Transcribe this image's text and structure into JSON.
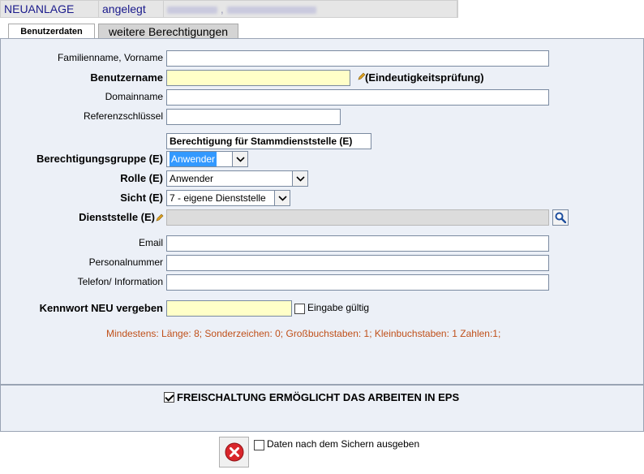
{
  "header": {
    "status": "NEUANLAGE",
    "state": "angelegt",
    "user_info": ""
  },
  "tabs": {
    "user_data": "Benutzerdaten",
    "more_permissions": "weitere Berechtigungen"
  },
  "form": {
    "name_label": "Familienname, Vorname",
    "name_value": "",
    "username_label": "Benutzername",
    "username_value": "",
    "uniqueness_check": "(Eindeutigkeitsprüfung)",
    "domain_label": "Domainname",
    "domain_value": "",
    "refkey_label": "Referenzschlüssel",
    "refkey_value": "",
    "section_title": "Berechtigung für Stammdienststelle (E)",
    "perm_group_label": "Berechtigungsgruppe (E)",
    "perm_group_value": "Anwender",
    "role_label": "Rolle (E)",
    "role_value": "Anwender",
    "view_label": "Sicht (E)",
    "view_value": "7 - eigene Dienststelle",
    "office_label": "Dienststelle (E)",
    "office_value": "",
    "email_label": "Email",
    "email_value": "",
    "personnel_label": "Personalnummer",
    "personnel_value": "",
    "phone_label": "Telefon/ Information",
    "phone_value": "",
    "password_label": "Kennwort NEU vergeben",
    "password_value": "",
    "input_valid_label": "Eingabe gültig",
    "password_hint": "Mindestens: Länge: 8; Sonderzeichen: 0; Großbuchstaben: 1; Kleinbuchstaben: 1 Zahlen:1;"
  },
  "activation": {
    "label": "FREISCHALTUNG ERMÖGLICHT DAS ARBEITEN IN EPS",
    "checked": true
  },
  "footer": {
    "output_after_save_label": "Daten nach dem Sichern ausgeben",
    "output_after_save_checked": false
  },
  "colors": {
    "panel_bg": "#ecf0f7",
    "header_text": "#1a1a8c",
    "hint_text": "#c0501a",
    "required_field_bg": "#ffffc8",
    "select_highlight": "#3399ff",
    "cancel_red": "#d9262b"
  },
  "icons": {
    "pencil": "pencil-icon",
    "search": "magnifier-icon",
    "cancel": "cancel-x-icon",
    "dropdown": "chevron-down-icon"
  }
}
